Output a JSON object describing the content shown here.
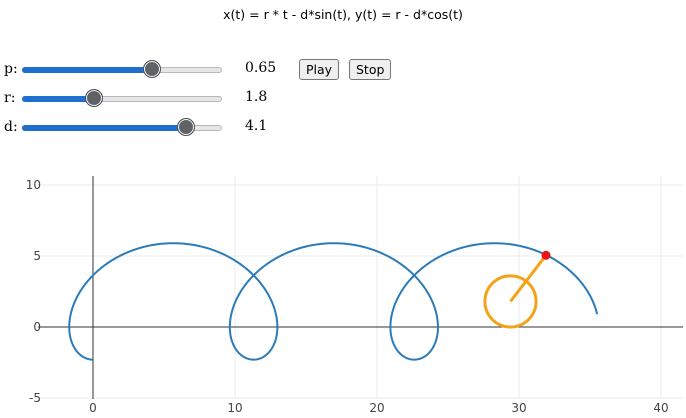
{
  "title": "x(t) = r * t - d*sin(t), y(t) = r - d*cos(t)",
  "controls": [
    {
      "label": "p:",
      "value": 0.65,
      "display": "0.65",
      "min": 0,
      "max": 1
    },
    {
      "label": "r:",
      "value": 1.8,
      "display": "1.8",
      "min": 0,
      "max": 5
    },
    {
      "label": "d:",
      "value": 4.1,
      "display": "4.1",
      "min": 0,
      "max": 5
    }
  ],
  "buttons": {
    "play": "Play",
    "stop": "Stop"
  },
  "chart_data": {
    "type": "line",
    "title": "",
    "xlabel": "",
    "ylabel": "",
    "xlim": [
      -4.5,
      42
    ],
    "ylim": [
      -5,
      10
    ],
    "xticks": [
      0,
      10,
      20,
      30,
      40
    ],
    "yticks": [
      -5,
      0,
      5,
      10
    ],
    "grid": true,
    "series": [
      {
        "kind": "trochoid",
        "t_range": [
          0,
          17.5
        ],
        "r": 1.8,
        "d": 4.1,
        "color": "#2b7bb9"
      }
    ],
    "circle": {
      "center": [
        29.4,
        1.8
      ],
      "radius": 1.8,
      "color": "#f5a21b"
    },
    "spoke": {
      "from": [
        29.4,
        1.8
      ],
      "to": [
        31.9,
        5.05
      ],
      "color": "#f5a21b"
    },
    "point": {
      "x": 31.9,
      "y": 5.05,
      "color": "#e8161a"
    }
  }
}
